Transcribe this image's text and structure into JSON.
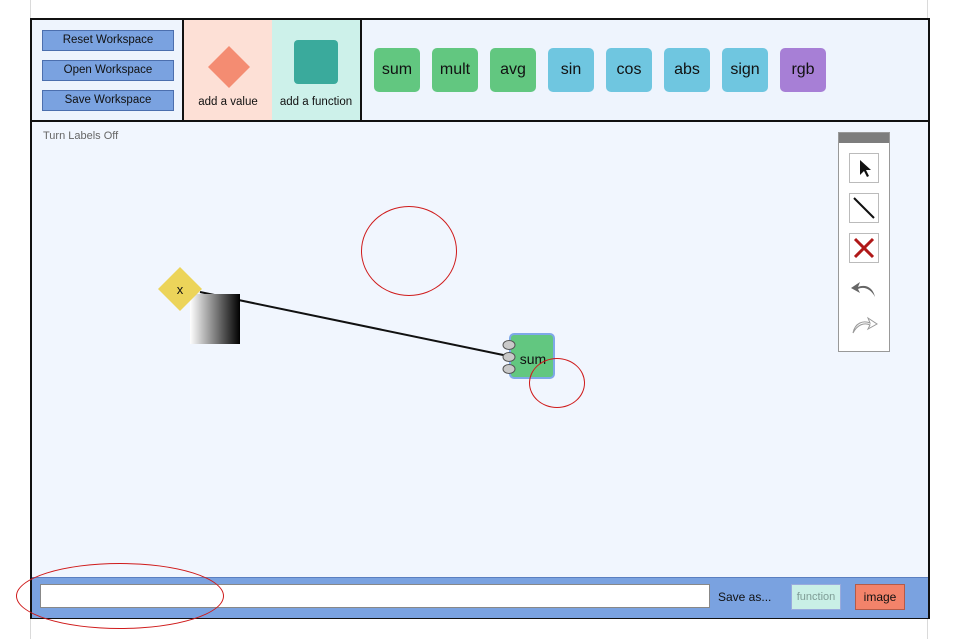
{
  "workspace_buttons": {
    "reset": "Reset Workspace",
    "open": "Open Workspace",
    "save": "Save Workspace"
  },
  "tiles": {
    "add_value": "add a value",
    "add_function": "add a function"
  },
  "functions": [
    {
      "label": "sum",
      "color": "#62c780"
    },
    {
      "label": "mult",
      "color": "#62c780"
    },
    {
      "label": "avg",
      "color": "#62c780"
    },
    {
      "label": "sin",
      "color": "#6fc6e0"
    },
    {
      "label": "cos",
      "color": "#6fc6e0"
    },
    {
      "label": "abs",
      "color": "#6fc6e0"
    },
    {
      "label": "sign",
      "color": "#6fc6e0"
    },
    {
      "label": "rgb",
      "color": "#a77fd6"
    }
  ],
  "canvas": {
    "labels_toggle": "Turn Labels Off",
    "value_node_label": "x",
    "function_node_label": "sum"
  },
  "toolbox": {
    "tools": [
      "pointer-icon",
      "line-icon",
      "delete-icon",
      "undo-icon",
      "redo-icon"
    ]
  },
  "bottom": {
    "name_value": "",
    "save_as": "Save as...",
    "format_function": "function",
    "format_image": "image"
  },
  "colors": {
    "value_tile_bg": "#fde0d6",
    "value_diamond": "#f48c72",
    "function_tile_bg": "#cdf1ea",
    "function_square": "#3aaa9c",
    "node_yellow": "#ecd45a",
    "annotation_red": "#cf1b1b"
  }
}
